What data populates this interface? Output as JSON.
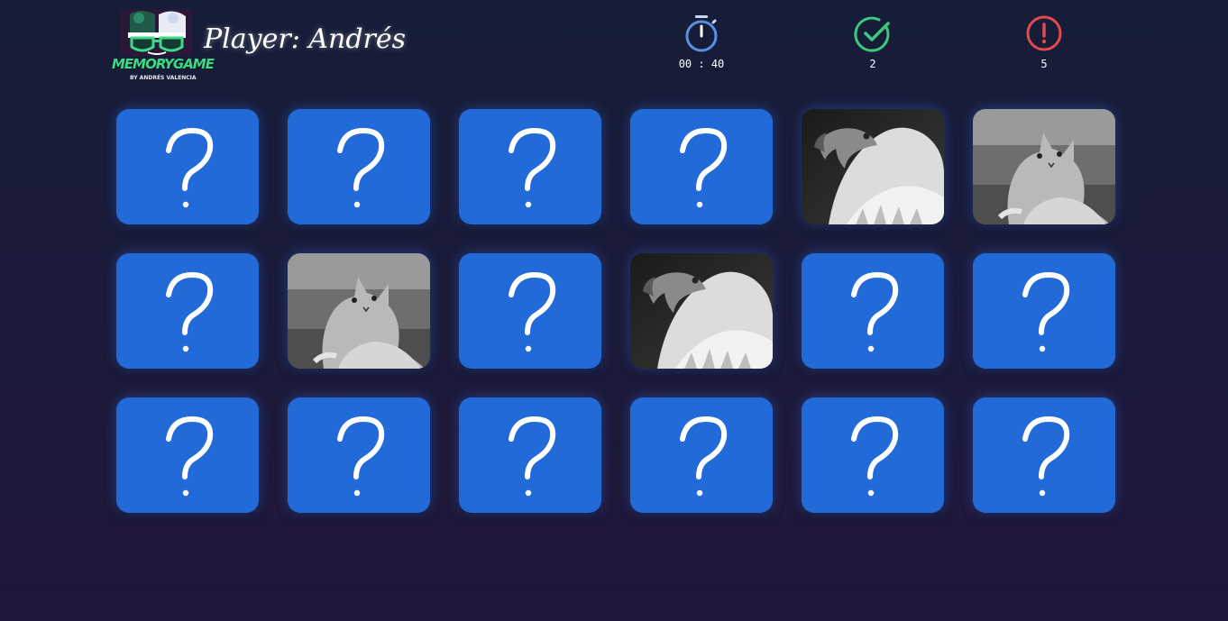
{
  "header": {
    "logo_text": "MEMORYGAME",
    "logo_subtitle": "BY ANDRÉS VALENCIA",
    "player_label": "Player: Andrés"
  },
  "stats": {
    "timer": {
      "icon": "stopwatch-icon",
      "value": "00 : 40",
      "color": "#5b8fe6"
    },
    "hits": {
      "icon": "check-circle-icon",
      "value": "2",
      "color": "#3ec97a"
    },
    "misses": {
      "icon": "alert-circle-icon",
      "value": "5",
      "color": "#e5484d"
    }
  },
  "colors": {
    "card_back": "#226ad8",
    "background_top": "#161d38",
    "background_bottom": "#22163a"
  },
  "board": {
    "rows": 3,
    "columns": 6,
    "cards": [
      {
        "state": "hidden",
        "face": "question-mark-icon"
      },
      {
        "state": "hidden",
        "face": "question-mark-icon"
      },
      {
        "state": "hidden",
        "face": "question-mark-icon"
      },
      {
        "state": "hidden",
        "face": "question-mark-icon"
      },
      {
        "state": "revealed",
        "face": "eagle-image"
      },
      {
        "state": "revealed",
        "face": "cat-image"
      },
      {
        "state": "hidden",
        "face": "question-mark-icon"
      },
      {
        "state": "revealed",
        "face": "cat-image"
      },
      {
        "state": "hidden",
        "face": "question-mark-icon"
      },
      {
        "state": "revealed",
        "face": "eagle-image"
      },
      {
        "state": "hidden",
        "face": "question-mark-icon"
      },
      {
        "state": "hidden",
        "face": "question-mark-icon"
      },
      {
        "state": "hidden",
        "face": "question-mark-icon"
      },
      {
        "state": "hidden",
        "face": "question-mark-icon"
      },
      {
        "state": "hidden",
        "face": "question-mark-icon"
      },
      {
        "state": "hidden",
        "face": "question-mark-icon"
      },
      {
        "state": "hidden",
        "face": "question-mark-icon"
      },
      {
        "state": "hidden",
        "face": "question-mark-icon"
      }
    ]
  }
}
